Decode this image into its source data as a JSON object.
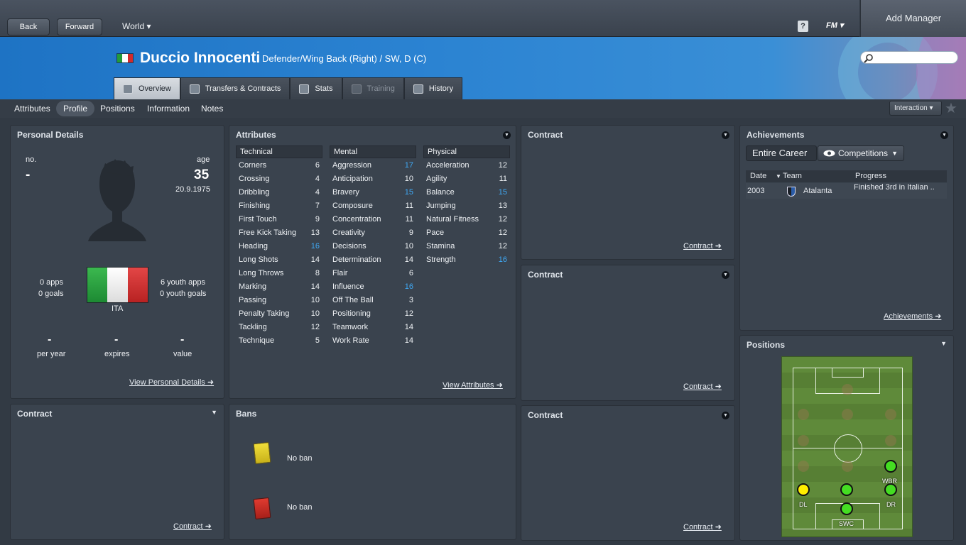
{
  "nav": {
    "back": "Back",
    "forward": "Forward",
    "world": "World ▾",
    "help": "?",
    "fm": "FM ▾",
    "add_manager": "Add Manager"
  },
  "player": {
    "name": "Duccio Innocenti",
    "position": "Defender/Wing Back (Right) / SW, D (C)"
  },
  "tabs": [
    {
      "label": "Overview",
      "active": true
    },
    {
      "label": "Transfers & Contracts"
    },
    {
      "label": "Stats"
    },
    {
      "label": "Training",
      "disabled": true
    },
    {
      "label": "History"
    }
  ],
  "subnav": [
    {
      "label": "Attributes"
    },
    {
      "label": "Profile",
      "active": true
    },
    {
      "label": "Positions"
    },
    {
      "label": "Information"
    },
    {
      "label": "Notes"
    }
  ],
  "interaction": "Interaction ▾",
  "personal": {
    "title": "Personal Details",
    "no_label": "no.",
    "no_value": "-",
    "age_label": "age",
    "age_value": "35",
    "dob": "20.9.1975",
    "apps": "0 apps",
    "goals": "0 goals",
    "youth_apps": "6 youth apps",
    "youth_goals": "0 youth goals",
    "nation": "ITA",
    "wage_value": "-",
    "wage_label": "per year",
    "expires_value": "-",
    "expires_label": "expires",
    "value_value": "-",
    "value_label": "value",
    "link": "View Personal Details ➜"
  },
  "attributes": {
    "title": "Attributes",
    "technical": {
      "header": "Technical",
      "rows": [
        [
          "Corners",
          "6"
        ],
        [
          "Crossing",
          "4"
        ],
        [
          "Dribbling",
          "4"
        ],
        [
          "Finishing",
          "7"
        ],
        [
          "First Touch",
          "9"
        ],
        [
          "Free Kick Taking",
          "13"
        ],
        [
          "Heading",
          "16"
        ],
        [
          "Long Shots",
          "14"
        ],
        [
          "Long Throws",
          "8"
        ],
        [
          "Marking",
          "14"
        ],
        [
          "Passing",
          "10"
        ],
        [
          "Penalty Taking",
          "10"
        ],
        [
          "Tackling",
          "12"
        ],
        [
          "Technique",
          "5"
        ]
      ]
    },
    "mental": {
      "header": "Mental",
      "rows": [
        [
          "Aggression",
          "17"
        ],
        [
          "Anticipation",
          "10"
        ],
        [
          "Bravery",
          "15"
        ],
        [
          "Composure",
          "11"
        ],
        [
          "Concentration",
          "11"
        ],
        [
          "Creativity",
          "9"
        ],
        [
          "Decisions",
          "10"
        ],
        [
          "Determination",
          "14"
        ],
        [
          "Flair",
          "6"
        ],
        [
          "Influence",
          "16"
        ],
        [
          "Off The Ball",
          "3"
        ],
        [
          "Positioning",
          "12"
        ],
        [
          "Teamwork",
          "14"
        ],
        [
          "Work Rate",
          "14"
        ]
      ]
    },
    "physical": {
      "header": "Physical",
      "rows": [
        [
          "Acceleration",
          "12"
        ],
        [
          "Agility",
          "11"
        ],
        [
          "Balance",
          "15"
        ],
        [
          "Jumping",
          "13"
        ],
        [
          "Natural Fitness",
          "12"
        ],
        [
          "Pace",
          "12"
        ],
        [
          "Stamina",
          "12"
        ],
        [
          "Strength",
          "16"
        ]
      ]
    },
    "link": "View Attributes ➜"
  },
  "contract": {
    "title": "Contract",
    "link": "Contract ➜"
  },
  "bans": {
    "title": "Bans",
    "yellow": "No ban",
    "red": "No ban"
  },
  "achievements": {
    "title": "Achievements",
    "btn_career": "Entire Career",
    "btn_comp": "Competitions",
    "headers": {
      "date": "Date",
      "team": "Team",
      "progress": "Progress"
    },
    "rows": [
      {
        "date": "2003",
        "team": "Atalanta",
        "progress": "Finished 3rd in Italian .."
      }
    ],
    "link": "Achievements ➜"
  },
  "positions": {
    "title": "Positions",
    "labels": {
      "wbr": "WBR",
      "dl": "DL",
      "dr": "DR",
      "swc": "SWC"
    }
  },
  "colors": {
    "accent": "#3fa9f5",
    "natural": "#44dd22",
    "accomplished": "#ffee00"
  }
}
